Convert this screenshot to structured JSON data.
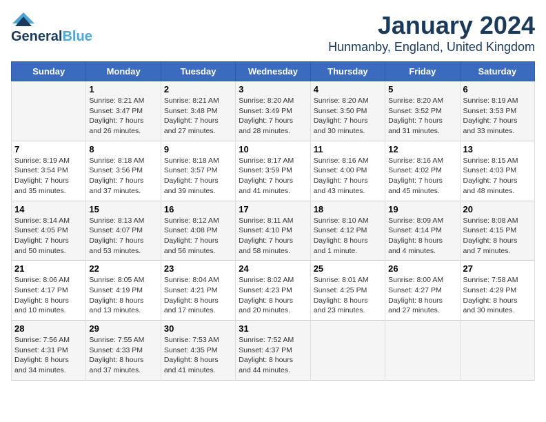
{
  "header": {
    "logo_line1_dark": "General",
    "logo_line1_blue": "Blue",
    "month": "January 2024",
    "location": "Hunmanby, England, United Kingdom"
  },
  "days_of_week": [
    "Sunday",
    "Monday",
    "Tuesday",
    "Wednesday",
    "Thursday",
    "Friday",
    "Saturday"
  ],
  "weeks": [
    [
      {
        "day": "",
        "info": ""
      },
      {
        "day": "1",
        "info": "Sunrise: 8:21 AM\nSunset: 3:47 PM\nDaylight: 7 hours\nand 26 minutes."
      },
      {
        "day": "2",
        "info": "Sunrise: 8:21 AM\nSunset: 3:48 PM\nDaylight: 7 hours\nand 27 minutes."
      },
      {
        "day": "3",
        "info": "Sunrise: 8:20 AM\nSunset: 3:49 PM\nDaylight: 7 hours\nand 28 minutes."
      },
      {
        "day": "4",
        "info": "Sunrise: 8:20 AM\nSunset: 3:50 PM\nDaylight: 7 hours\nand 30 minutes."
      },
      {
        "day": "5",
        "info": "Sunrise: 8:20 AM\nSunset: 3:52 PM\nDaylight: 7 hours\nand 31 minutes."
      },
      {
        "day": "6",
        "info": "Sunrise: 8:19 AM\nSunset: 3:53 PM\nDaylight: 7 hours\nand 33 minutes."
      }
    ],
    [
      {
        "day": "7",
        "info": "Sunrise: 8:19 AM\nSunset: 3:54 PM\nDaylight: 7 hours\nand 35 minutes."
      },
      {
        "day": "8",
        "info": "Sunrise: 8:18 AM\nSunset: 3:56 PM\nDaylight: 7 hours\nand 37 minutes."
      },
      {
        "day": "9",
        "info": "Sunrise: 8:18 AM\nSunset: 3:57 PM\nDaylight: 7 hours\nand 39 minutes."
      },
      {
        "day": "10",
        "info": "Sunrise: 8:17 AM\nSunset: 3:59 PM\nDaylight: 7 hours\nand 41 minutes."
      },
      {
        "day": "11",
        "info": "Sunrise: 8:16 AM\nSunset: 4:00 PM\nDaylight: 7 hours\nand 43 minutes."
      },
      {
        "day": "12",
        "info": "Sunrise: 8:16 AM\nSunset: 4:02 PM\nDaylight: 7 hours\nand 45 minutes."
      },
      {
        "day": "13",
        "info": "Sunrise: 8:15 AM\nSunset: 4:03 PM\nDaylight: 7 hours\nand 48 minutes."
      }
    ],
    [
      {
        "day": "14",
        "info": "Sunrise: 8:14 AM\nSunset: 4:05 PM\nDaylight: 7 hours\nand 50 minutes."
      },
      {
        "day": "15",
        "info": "Sunrise: 8:13 AM\nSunset: 4:07 PM\nDaylight: 7 hours\nand 53 minutes."
      },
      {
        "day": "16",
        "info": "Sunrise: 8:12 AM\nSunset: 4:08 PM\nDaylight: 7 hours\nand 56 minutes."
      },
      {
        "day": "17",
        "info": "Sunrise: 8:11 AM\nSunset: 4:10 PM\nDaylight: 7 hours\nand 58 minutes."
      },
      {
        "day": "18",
        "info": "Sunrise: 8:10 AM\nSunset: 4:12 PM\nDaylight: 8 hours\nand 1 minute."
      },
      {
        "day": "19",
        "info": "Sunrise: 8:09 AM\nSunset: 4:14 PM\nDaylight: 8 hours\nand 4 minutes."
      },
      {
        "day": "20",
        "info": "Sunrise: 8:08 AM\nSunset: 4:15 PM\nDaylight: 8 hours\nand 7 minutes."
      }
    ],
    [
      {
        "day": "21",
        "info": "Sunrise: 8:06 AM\nSunset: 4:17 PM\nDaylight: 8 hours\nand 10 minutes."
      },
      {
        "day": "22",
        "info": "Sunrise: 8:05 AM\nSunset: 4:19 PM\nDaylight: 8 hours\nand 13 minutes."
      },
      {
        "day": "23",
        "info": "Sunrise: 8:04 AM\nSunset: 4:21 PM\nDaylight: 8 hours\nand 17 minutes."
      },
      {
        "day": "24",
        "info": "Sunrise: 8:02 AM\nSunset: 4:23 PM\nDaylight: 8 hours\nand 20 minutes."
      },
      {
        "day": "25",
        "info": "Sunrise: 8:01 AM\nSunset: 4:25 PM\nDaylight: 8 hours\nand 23 minutes."
      },
      {
        "day": "26",
        "info": "Sunrise: 8:00 AM\nSunset: 4:27 PM\nDaylight: 8 hours\nand 27 minutes."
      },
      {
        "day": "27",
        "info": "Sunrise: 7:58 AM\nSunset: 4:29 PM\nDaylight: 8 hours\nand 30 minutes."
      }
    ],
    [
      {
        "day": "28",
        "info": "Sunrise: 7:56 AM\nSunset: 4:31 PM\nDaylight: 8 hours\nand 34 minutes."
      },
      {
        "day": "29",
        "info": "Sunrise: 7:55 AM\nSunset: 4:33 PM\nDaylight: 8 hours\nand 37 minutes."
      },
      {
        "day": "30",
        "info": "Sunrise: 7:53 AM\nSunset: 4:35 PM\nDaylight: 8 hours\nand 41 minutes."
      },
      {
        "day": "31",
        "info": "Sunrise: 7:52 AM\nSunset: 4:37 PM\nDaylight: 8 hours\nand 44 minutes."
      },
      {
        "day": "",
        "info": ""
      },
      {
        "day": "",
        "info": ""
      },
      {
        "day": "",
        "info": ""
      }
    ]
  ]
}
